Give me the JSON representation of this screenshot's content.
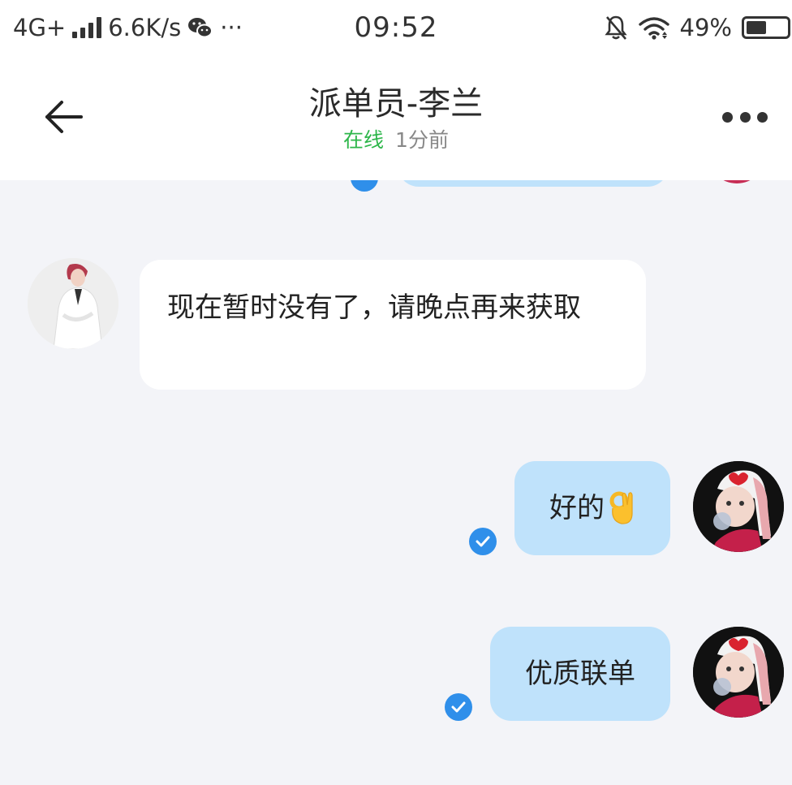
{
  "status_bar": {
    "network": "4G+",
    "speed": "6.6K/s",
    "more": "···",
    "time": "09:52",
    "battery": "49%",
    "battery_level": 0.49
  },
  "header": {
    "title": "派单员-李兰",
    "status": "在线",
    "last_seen": "1分前"
  },
  "messages": [
    {
      "direction": "incoming",
      "text": "现在暂时没有了，请晚点再来获取"
    },
    {
      "direction": "outgoing",
      "text": "好的",
      "emoji": "ok-hand",
      "read": true
    },
    {
      "direction": "outgoing",
      "text": "优质联单",
      "read": true
    }
  ],
  "colors": {
    "online": "#2db64a",
    "outgoing_bubble": "#bfe2fb",
    "incoming_bubble": "#ffffff",
    "read_check": "#2f8fea",
    "chat_background": "#f3f4f8"
  }
}
